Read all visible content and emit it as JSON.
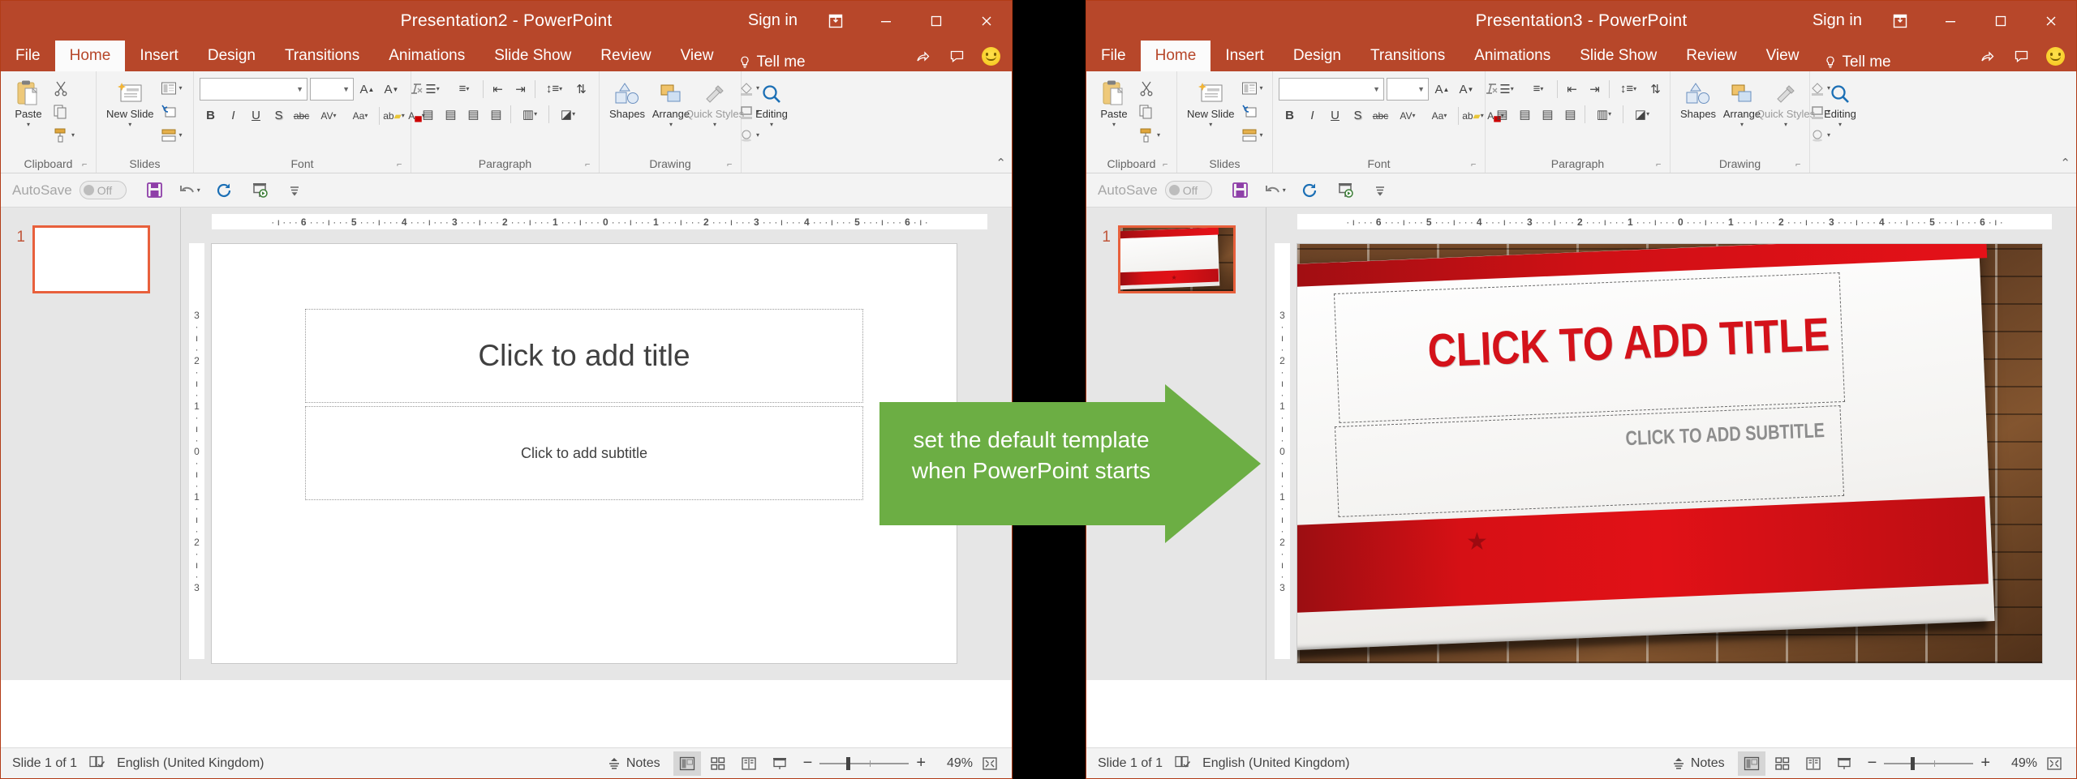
{
  "annotation": {
    "line1": "set the default template",
    "line2": "when PowerPoint starts",
    "arrow_color": "#6cae44"
  },
  "theme": {
    "accent": "#b7472a",
    "slide_selected_border": "#e8603c",
    "template_title_red": "#d4121a",
    "template_subtitle_gray": "#8d8d8d"
  },
  "windows": [
    {
      "id": "left",
      "titlebar": {
        "title": "Presentation2  -  PowerPoint",
        "signin": "Sign in",
        "ribbon_display_icon": "ribbon-display-options-icon",
        "minimize_icon": "minimize-icon",
        "maximize_icon": "maximize-icon",
        "close_icon": "close-icon"
      },
      "tabs": [
        {
          "label": "File",
          "active": false
        },
        {
          "label": "Home",
          "active": true
        },
        {
          "label": "Insert",
          "active": false
        },
        {
          "label": "Design",
          "active": false
        },
        {
          "label": "Transitions",
          "active": false
        },
        {
          "label": "Animations",
          "active": false
        },
        {
          "label": "Slide Show",
          "active": false
        },
        {
          "label": "Review",
          "active": false
        },
        {
          "label": "View",
          "active": false
        }
      ],
      "tellme": "Tell me",
      "tabstrip_right": {
        "share_icon": "share-icon",
        "comments_icon": "comments-icon",
        "account_icon": "smiley-face-icon"
      },
      "ribbon": {
        "groups": [
          {
            "label": "Clipboard",
            "has_launcher": true,
            "buttons": [
              {
                "label": "Paste",
                "icon": "clipboard-paste-icon",
                "split": true
              },
              {
                "label": "Cut",
                "icon": "scissors-icon"
              },
              {
                "label": "Copy",
                "icon": "copy-icon"
              },
              {
                "label": "Format Painter",
                "icon": "format-painter-icon"
              }
            ]
          },
          {
            "label": "Slides",
            "has_launcher": false,
            "buttons": [
              {
                "label": "New Slide",
                "icon": "new-slide-icon",
                "split": true
              },
              {
                "label": "Layout",
                "icon": "layout-icon"
              },
              {
                "label": "Reset",
                "icon": "reset-icon"
              },
              {
                "label": "Section",
                "icon": "section-icon"
              }
            ]
          },
          {
            "label": "Font",
            "has_launcher": true,
            "font_name_value": "",
            "font_size_value": "",
            "buttons": [
              {
                "label": "Increase Font Size",
                "icon": "increase-font-size-icon"
              },
              {
                "label": "Decrease Font Size",
                "icon": "decrease-font-size-icon"
              },
              {
                "label": "Clear All Formatting",
                "icon": "clear-formatting-icon"
              },
              {
                "label": "Bold",
                "icon": "bold-icon",
                "glyph": "B"
              },
              {
                "label": "Italic",
                "icon": "italic-icon",
                "glyph": "I"
              },
              {
                "label": "Underline",
                "icon": "underline-icon",
                "glyph": "U"
              },
              {
                "label": "Text Shadow",
                "icon": "text-shadow-icon",
                "glyph": "S"
              },
              {
                "label": "Strikethrough",
                "icon": "strikethrough-icon",
                "glyph": "abc"
              },
              {
                "label": "Character Spacing",
                "icon": "character-spacing-icon",
                "glyph": "AV"
              },
              {
                "label": "Change Case",
                "icon": "change-case-icon",
                "glyph": "Aa"
              },
              {
                "label": "Text Highlight Color",
                "icon": "text-highlight-color-icon"
              },
              {
                "label": "Font Color",
                "icon": "font-color-icon",
                "glyph": "A"
              }
            ]
          },
          {
            "label": "Paragraph",
            "has_launcher": true,
            "buttons": [
              {
                "label": "Bullets",
                "icon": "bullets-icon"
              },
              {
                "label": "Numbering",
                "icon": "numbering-icon"
              },
              {
                "label": "Decrease List Level",
                "icon": "decrease-indent-icon"
              },
              {
                "label": "Increase List Level",
                "icon": "increase-indent-icon"
              },
              {
                "label": "Line Spacing",
                "icon": "line-spacing-icon"
              },
              {
                "label": "Text Direction",
                "icon": "text-direction-icon"
              },
              {
                "label": "Align Text",
                "icon": "align-text-icon"
              },
              {
                "label": "Convert to SmartArt",
                "icon": "smartart-icon"
              },
              {
                "label": "Align Left",
                "icon": "align-left-icon"
              },
              {
                "label": "Center",
                "icon": "align-center-icon"
              },
              {
                "label": "Align Right",
                "icon": "align-right-icon"
              },
              {
                "label": "Justify",
                "icon": "justify-icon"
              },
              {
                "label": "Columns",
                "icon": "columns-icon"
              }
            ]
          },
          {
            "label": "Drawing",
            "has_launcher": true,
            "buttons": [
              {
                "label": "Shapes",
                "icon": "shapes-icon"
              },
              {
                "label": "Arrange",
                "icon": "arrange-icon"
              },
              {
                "label": "Quick Styles",
                "icon": "quick-styles-icon"
              },
              {
                "label": "Shape Fill",
                "icon": "shape-fill-icon"
              },
              {
                "label": "Shape Outline",
                "icon": "shape-outline-icon"
              },
              {
                "label": "Shape Effects",
                "icon": "shape-effects-icon"
              }
            ]
          },
          {
            "label": "",
            "has_launcher": false,
            "buttons": [
              {
                "label": "Editing",
                "icon": "editing-magnifier-icon"
              }
            ]
          }
        ],
        "collapse_icon": "collapse-ribbon-icon"
      },
      "qat": {
        "autosave_label": "AutoSave",
        "autosave_state": "Off",
        "buttons": [
          {
            "label": "Save",
            "icon": "save-icon"
          },
          {
            "label": "Undo",
            "icon": "undo-icon"
          },
          {
            "label": "Redo",
            "icon": "redo-icon"
          },
          {
            "label": "Start From Beginning",
            "icon": "start-slideshow-icon"
          },
          {
            "label": "Customize Quick Access Toolbar",
            "icon": "qat-overflow-icon"
          }
        ]
      },
      "thumbnail": {
        "number": "1",
        "kind": "blank"
      },
      "ruler": {
        "horizontal": [
          "6",
          "5",
          "4",
          "3",
          "2",
          "1",
          "0",
          "1",
          "2",
          "3",
          "4",
          "5",
          "6"
        ],
        "vertical": [
          "3",
          "2",
          "1",
          "0",
          "1",
          "2",
          "3"
        ]
      },
      "slide": {
        "kind": "blank",
        "title_placeholder": "Click to add title",
        "subtitle_placeholder": "Click to add subtitle"
      },
      "statusbar": {
        "slide_count": "Slide 1 of 1",
        "spellcheck_icon": "spell-check-icon",
        "language": "English (United Kingdom)",
        "notes_label": "Notes",
        "notes_icon": "notes-icon",
        "views": [
          {
            "name": "normal-view",
            "active": true
          },
          {
            "name": "slide-sorter-view",
            "active": false
          },
          {
            "name": "reading-view",
            "active": false
          },
          {
            "name": "slide-show-view",
            "active": false
          }
        ],
        "zoom_out_icon": "zoom-out-icon",
        "zoom_in_icon": "zoom-in-icon",
        "zoom_level": "49%",
        "fit_icon": "fit-slide-to-window-icon"
      }
    },
    {
      "id": "right",
      "titlebar": {
        "title": "Presentation3  -  PowerPoint",
        "signin": "Sign in",
        "ribbon_display_icon": "ribbon-display-options-icon",
        "minimize_icon": "minimize-icon",
        "maximize_icon": "maximize-icon",
        "close_icon": "close-icon"
      },
      "tabs": [
        {
          "label": "File",
          "active": false
        },
        {
          "label": "Home",
          "active": true
        },
        {
          "label": "Insert",
          "active": false
        },
        {
          "label": "Design",
          "active": false
        },
        {
          "label": "Transitions",
          "active": false
        },
        {
          "label": "Animations",
          "active": false
        },
        {
          "label": "Slide Show",
          "active": false
        },
        {
          "label": "Review",
          "active": false
        },
        {
          "label": "View",
          "active": false
        }
      ],
      "tellme": "Tell me",
      "tabstrip_right": {
        "share_icon": "share-icon",
        "comments_icon": "comments-icon",
        "account_icon": "smiley-face-icon"
      },
      "ribbon": {
        "groups": [
          {
            "label": "Clipboard",
            "has_launcher": true
          },
          {
            "label": "Slides",
            "has_launcher": false
          },
          {
            "label": "Font",
            "has_launcher": true,
            "font_name_value": "",
            "font_size_value": ""
          },
          {
            "label": "Paragraph",
            "has_launcher": true
          },
          {
            "label": "Drawing",
            "has_launcher": true
          },
          {
            "label": "",
            "has_launcher": false
          }
        ],
        "collapse_icon": "collapse-ribbon-icon"
      },
      "qat": {
        "autosave_label": "AutoSave",
        "autosave_state": "Off"
      },
      "thumbnail": {
        "number": "1",
        "kind": "template"
      },
      "ruler": {
        "horizontal": [
          "6",
          "5",
          "4",
          "3",
          "2",
          "1",
          "0",
          "1",
          "2",
          "3",
          "4",
          "5",
          "6"
        ],
        "vertical": [
          "3",
          "2",
          "1",
          "0",
          "1",
          "2",
          "3"
        ]
      },
      "slide": {
        "kind": "template",
        "title_placeholder": "CLICK TO ADD TITLE",
        "subtitle_placeholder": "CLICK TO ADD SUBTITLE"
      },
      "statusbar": {
        "slide_count": "Slide 1 of 1",
        "spellcheck_icon": "spell-check-icon",
        "language": "English (United Kingdom)",
        "notes_label": "Notes",
        "notes_icon": "notes-icon",
        "views": [
          {
            "name": "normal-view",
            "active": true
          },
          {
            "name": "slide-sorter-view",
            "active": false
          },
          {
            "name": "reading-view",
            "active": false
          },
          {
            "name": "slide-show-view",
            "active": false
          }
        ],
        "zoom_out_icon": "zoom-out-icon",
        "zoom_in_icon": "zoom-in-icon",
        "zoom_level": "49%",
        "fit_icon": "fit-slide-to-window-icon"
      }
    }
  ]
}
